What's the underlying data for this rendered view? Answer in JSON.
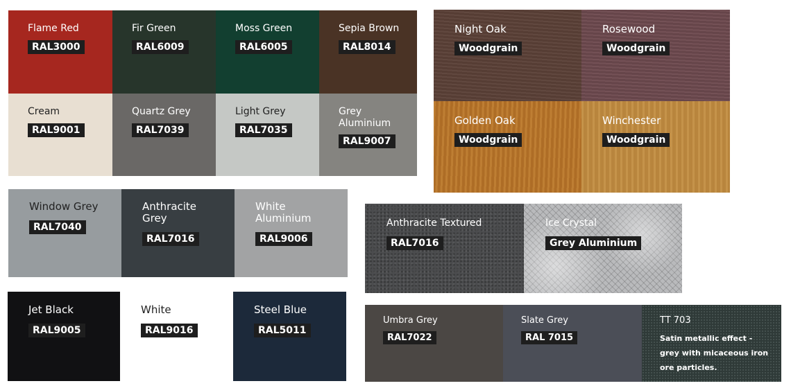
{
  "groups": {
    "solid_top": [
      {
        "name": "Flame Red",
        "code": "RAL3000",
        "color": "#a6271f",
        "text": "light"
      },
      {
        "name": "Fir Green",
        "code": "RAL6009",
        "color": "#27352b",
        "text": "light"
      },
      {
        "name": "Moss Green",
        "code": "RAL6005",
        "color": "#123f30",
        "text": "light"
      },
      {
        "name": "Sepia Brown",
        "code": "RAL8014",
        "color": "#4a3325",
        "text": "light"
      },
      {
        "name": "Cream",
        "code": "RAL9001",
        "color": "#e8dfd2",
        "text": "dark"
      },
      {
        "name": "Quartz Grey",
        "code": "RAL7039",
        "color": "#6a6866",
        "text": "light"
      },
      {
        "name": "Light Grey",
        "code": "RAL7035",
        "color": "#c5c8c5",
        "text": "dark"
      },
      {
        "name": "Grey\nAluminium",
        "code": "RAL9007",
        "color": "#858480",
        "text": "light"
      }
    ],
    "woodgrain": [
      {
        "name": "Night Oak",
        "code": "Woodgrain",
        "texture": "wood-night"
      },
      {
        "name": "Rosewood",
        "code": "Woodgrain",
        "texture": "wood-rose"
      },
      {
        "name": "Golden Oak",
        "code": "Woodgrain",
        "texture": "wood-golden"
      },
      {
        "name": "Winchester",
        "code": "Woodgrain",
        "texture": "wood-win"
      }
    ],
    "solid_middle": [
      {
        "name": "Window Grey",
        "code": "RAL7040",
        "color": "#979c9f",
        "text": "dark"
      },
      {
        "name": "Anthracite\nGrey",
        "code": "RAL7016",
        "color": "#383e42",
        "text": "light"
      },
      {
        "name": "White\nAluminium",
        "code": "RAL9006",
        "color": "#a2a3a4",
        "text": "light"
      }
    ],
    "textured": [
      {
        "name": "Anthracite Textured",
        "code": "RAL7016",
        "texture": "tex-anth"
      },
      {
        "name": "Ice Crystal",
        "code": "Grey Aluminium",
        "texture": "tex-ice"
      }
    ],
    "solid_bottom": [
      {
        "name": "Jet Black",
        "code": "RAL9005",
        "color": "#111113",
        "text": "light"
      },
      {
        "name": "White",
        "code": "RAL9016",
        "color": "#ffffff",
        "text": "dark"
      },
      {
        "name": "Steel Blue",
        "code": "RAL5011",
        "color": "#1c293a",
        "text": "light"
      }
    ],
    "metallic": [
      {
        "name": "Umbra Grey",
        "code": "RAL7022",
        "color": "#4b4744",
        "text": "light"
      },
      {
        "name": "Slate Grey",
        "code": "RAL 7015",
        "color": "#4b4e57",
        "text": "light"
      },
      {
        "name": "TT 703",
        "description": "Satin metallic effect - grey with micaceous iron ore particles.",
        "texture": "tex-tt"
      }
    ]
  }
}
